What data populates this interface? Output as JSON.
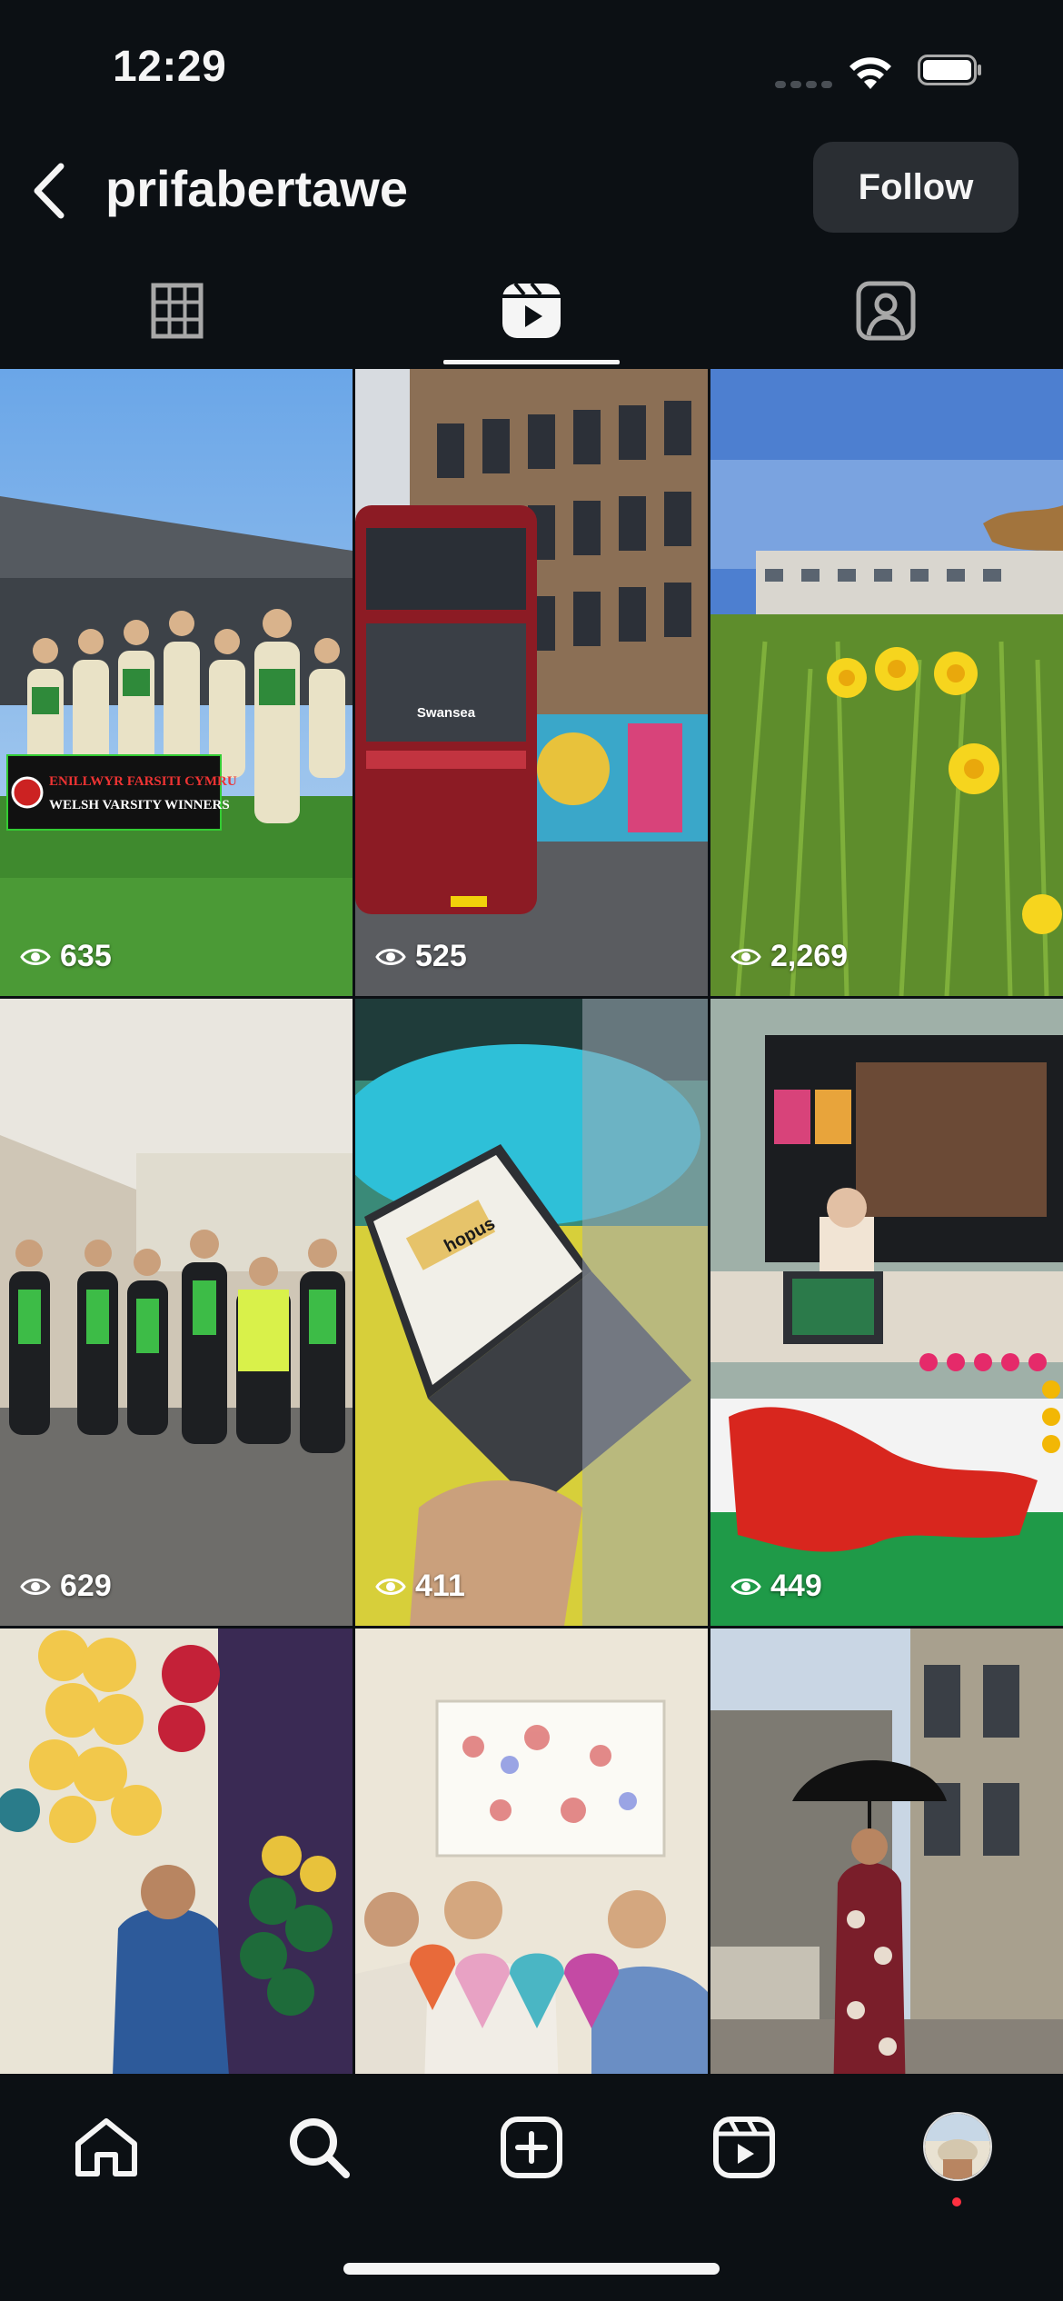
{
  "status_bar": {
    "time": "12:29"
  },
  "header": {
    "username": "prifabertawe",
    "follow_label": "Follow"
  },
  "tabs": [
    {
      "name": "grid",
      "icon": "grid-icon",
      "selected": false
    },
    {
      "name": "reels",
      "icon": "reels-icon",
      "selected": true
    },
    {
      "name": "tagged",
      "icon": "tagged-icon",
      "selected": false
    }
  ],
  "reels": [
    {
      "views": "635",
      "subject": "rugby team celebrating",
      "banner_line1": "ENILLWYR FARSITI CYMRU",
      "banner_line2": "WELSH VARSITY WINNERS"
    },
    {
      "views": "525",
      "subject": "red double-decker bus",
      "bus_text": "Swansea"
    },
    {
      "views": "2,269",
      "subject": "daffodils on campus"
    },
    {
      "views": "629",
      "subject": "students in green t-shirts"
    },
    {
      "views": "411",
      "subject": "laptop on desk",
      "screen_text": "hopus"
    },
    {
      "views": "449",
      "subject": "exhibition stand with Welsh flag"
    },
    {
      "views": "",
      "subject": "balloon party"
    },
    {
      "views": "",
      "subject": "students holding hearts"
    },
    {
      "views": "",
      "subject": "woman with umbrella outside building"
    }
  ],
  "bottom_nav": [
    {
      "name": "home",
      "icon": "home-icon"
    },
    {
      "name": "search",
      "icon": "search-icon"
    },
    {
      "name": "create",
      "icon": "plus-square-icon"
    },
    {
      "name": "reels",
      "icon": "reels-icon"
    },
    {
      "name": "profile",
      "icon": "avatar"
    }
  ],
  "colors": {
    "background": "#0c1014",
    "text": "#f5f5f5",
    "button": "#2a2e33",
    "notification": "#ff3040"
  }
}
